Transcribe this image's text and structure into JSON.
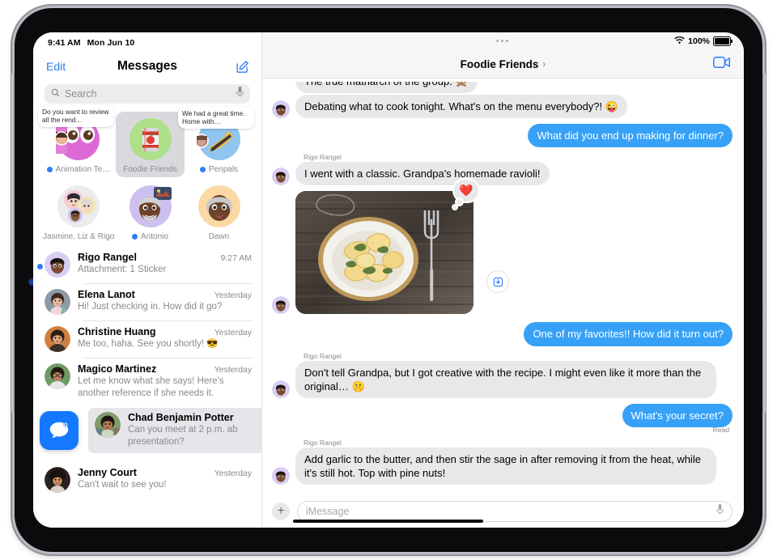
{
  "status_bar": {
    "time": "9:41 AM",
    "date": "Mon Jun 10",
    "battery_percent": "100%",
    "wifi_icon": "wifi-icon",
    "battery_icon": "battery-icon"
  },
  "sidebar": {
    "edit_label": "Edit",
    "title": "Messages",
    "compose_icon": "compose-icon",
    "search": {
      "placeholder": "Search",
      "icon": "search-icon",
      "mic_icon": "microphone-icon"
    },
    "pinned": [
      {
        "label": "Animation Te…",
        "unread": true,
        "preview": "Do you want to review all the rend…",
        "selected": false
      },
      {
        "label": "Foodie Friends",
        "unread": false,
        "preview": "",
        "selected": true
      },
      {
        "label": "Penpals",
        "unread": true,
        "preview": "We had a great time. Home with…",
        "selected": false
      },
      {
        "label": "Jasmine, Liz & Rigo",
        "unread": false,
        "preview": "",
        "selected": false
      },
      {
        "label": "Antonio",
        "unread": true,
        "preview": "",
        "selected": false
      },
      {
        "label": "Dawn",
        "unread": false,
        "preview": "",
        "selected": false
      }
    ],
    "conversations": [
      {
        "name": "Rigo Rangel",
        "time": "9:27 AM",
        "preview": "Attachment: 1 Sticker",
        "unread": true
      },
      {
        "name": "Elena Lanot",
        "time": "Yesterday",
        "preview": "Hi! Just checking in. How did it go?",
        "unread": false
      },
      {
        "name": "Christine Huang",
        "time": "Yesterday",
        "preview": "Me too, haha. See you shortly! 😎",
        "unread": false
      },
      {
        "name": "Magico Martinez",
        "time": "Yesterday",
        "preview": "Let me know what she says! Here's another reference if she needs it.",
        "unread": false
      },
      {
        "name": "Jenny Court",
        "time": "Yesterday",
        "preview": "Can't wait to see you!",
        "unread": false
      }
    ],
    "drag_item": {
      "app_icon": "messages-app-icon",
      "name": "Chad Benjamin Potter",
      "preview": "Can you meet at 2 p.m. ab presentation?"
    }
  },
  "chat": {
    "drag_handle_icon": "drag-handle-dots",
    "title": "Foodie Friends",
    "chevron_icon": "chevron-right-icon",
    "facetime_icon": "facetime-video-icon",
    "messages": [
      {
        "id": "m0",
        "dir": "in",
        "sender": "",
        "text": "The true matriarch of the group. 🙊",
        "clipped": true,
        "avatar": false
      },
      {
        "id": "m1",
        "dir": "in",
        "sender": "",
        "text": "Debating what to cook tonight. What's on the menu everybody?! 😜",
        "avatar": true
      },
      {
        "id": "m2",
        "dir": "out",
        "sender": "",
        "text": "What did you end up making for dinner?"
      },
      {
        "id": "m3",
        "dir": "in",
        "sender": "Rigo Rangel",
        "text": "I went with a classic. Grandpa's homemade ravioli!",
        "avatar": true
      },
      {
        "id": "m4",
        "dir": "in",
        "sender": "",
        "type": "photo",
        "alt": "plate-of-ravioli-photo",
        "tapback": "❤️",
        "save_icon": "save-to-photos-icon",
        "avatar": true
      },
      {
        "id": "m5",
        "dir": "out",
        "sender": "",
        "text": "One of my favorites!! How did it turn out?"
      },
      {
        "id": "m6",
        "dir": "in",
        "sender": "Rigo Rangel",
        "text": "Don't tell Grandpa, but I got creative with the recipe. I might even like it more than the original… 🤫",
        "avatar": true
      },
      {
        "id": "m7",
        "dir": "out",
        "sender": "",
        "text": "What's your secret?",
        "receipt": "Read"
      },
      {
        "id": "m8",
        "dir": "in",
        "sender": "Rigo Rangel",
        "text": "Add garlic to the butter, and then stir the sage in after removing it from the heat, while it's still hot. Top with pine nuts!",
        "avatar": true
      }
    ],
    "composer": {
      "plus_icon": "plus-icon",
      "placeholder": "iMessage",
      "mic_icon": "microphone-icon"
    }
  },
  "colors": {
    "accent_blue": "#2f7cf6",
    "bubble_out": "#36a1f7",
    "bubble_in": "#e8e8ea",
    "secondary_text": "#8a8a8f",
    "drag_icon_blue": "#1579ff"
  }
}
